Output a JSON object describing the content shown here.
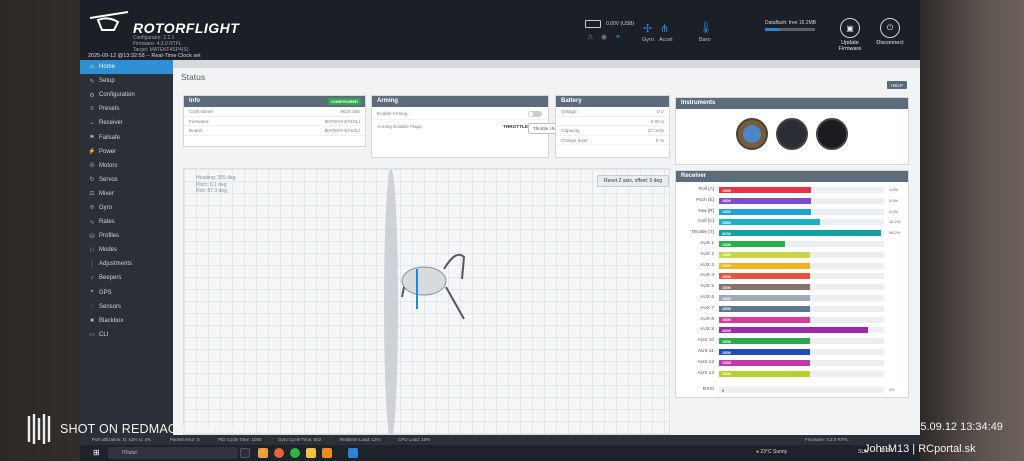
{
  "app": {
    "logo_text": "ROTORFLIGHT",
    "configurator": "Configurator: 2.2.1",
    "firmware": "Firmware: 4.3.0 RTFL",
    "target": "Target: MATEKF4SP4(S)",
    "datetime": "2025-09-12 @13:32:58 -- Real-Time Clock set"
  },
  "header": {
    "battery_value": "0.00V (USB)",
    "sensors": [
      {
        "icon": "gyro-icon",
        "label": "Gyro"
      },
      {
        "icon": "accel-icon",
        "label": "Accel"
      },
      {
        "icon": "baro-icon",
        "label": "Baro"
      }
    ],
    "dataflash": "Dataflash: free 16.2MB",
    "dataflash_used": 0.3,
    "update_label": "Update Firmware",
    "disconnect_label": "Disconnect"
  },
  "sidebar": {
    "items": [
      {
        "label": "Home",
        "icon": "home-icon",
        "active": true
      },
      {
        "label": "Setup",
        "icon": "wrench-icon"
      },
      {
        "label": "Configuration",
        "icon": "gear-icon"
      },
      {
        "label": "Presets",
        "icon": "presets-icon"
      },
      {
        "label": "Receiver",
        "icon": "receiver-icon"
      },
      {
        "label": "Failsafe",
        "icon": "failsafe-icon"
      },
      {
        "label": "Power",
        "icon": "power-icon"
      },
      {
        "label": "Motors",
        "icon": "motor-icon"
      },
      {
        "label": "Servos",
        "icon": "servo-icon"
      },
      {
        "label": "Mixer",
        "icon": "mixer-icon"
      },
      {
        "label": "Gyro",
        "icon": "gyro-icon"
      },
      {
        "label": "Rates",
        "icon": "rates-icon"
      },
      {
        "label": "Profiles",
        "icon": "profiles-icon"
      },
      {
        "label": "Modes",
        "icon": "modes-icon"
      },
      {
        "label": "Adjustments",
        "icon": "adjustments-icon"
      },
      {
        "label": "Beepers",
        "icon": "beeper-icon"
      },
      {
        "label": "GPS",
        "icon": "gps-icon"
      },
      {
        "label": "Sensors",
        "icon": "sensors-icon"
      },
      {
        "label": "Blackbox",
        "icon": "blackbox-icon"
      },
      {
        "label": "CLI",
        "icon": "cli-icon"
      }
    ]
  },
  "main": {
    "title": "Status",
    "help_label": "HELP",
    "info": {
      "title": "Info",
      "badge": "CONFIGURED",
      "rows": [
        {
          "k": "Craft Name:",
          "v": "RDS 450"
        },
        {
          "k": "Firmware:",
          "v": "MATEKF4(#4SL)"
        },
        {
          "k": "Board:",
          "v": "MATEKF4(#4SL)"
        }
      ]
    },
    "arming": {
      "title": "Arming",
      "enable_label": "Enable Arming:",
      "flags_label": "Arming Disable Flags:",
      "flags_value": "THROTTLE",
      "tooltip": "Throttle channel is too high"
    },
    "battery": {
      "title": "Battery",
      "rows": [
        {
          "k": "Voltage:",
          "v": "0 V"
        },
        {
          "k": "",
          "v": "0.00 A"
        },
        {
          "k": "Capacity:",
          "v": "27 mAh"
        },
        {
          "k": "Charge level:",
          "v": "0 %"
        }
      ]
    },
    "instruments": {
      "title": "Instruments"
    },
    "attitude": {
      "heading": "Heading:  355 deg",
      "pitch": "Pitch:  0.1 deg",
      "roll": "Roll:  87.3 deg"
    },
    "reset_label": "Reset Z axis, offset: 0 deg",
    "receiver": {
      "title": "Receiver",
      "rssi_label": "RSSI",
      "rssi_value": "0",
      "rssi_pct": "0%",
      "channels": [
        {
          "name": "Roll [A]",
          "value": "1500",
          "pct": "1.0%",
          "level": 0.56,
          "color": "#e8324a"
        },
        {
          "name": "Pitch [E]",
          "value": "1500",
          "pct": "0.0%",
          "level": 0.56,
          "color": "#7a4ec9"
        },
        {
          "name": "Yaw [R]",
          "value": "1501",
          "pct": "0.0%",
          "level": 0.56,
          "color": "#21a0d8"
        },
        {
          "name": "Coll [C]",
          "value": "1593",
          "pct": "18.2%",
          "level": 0.61,
          "color": "#19b3c7"
        },
        {
          "name": "Throttle [T]",
          "value": "2002",
          "pct": "98.2%",
          "level": 0.98,
          "color": "#11a2a0"
        },
        {
          "name": "AUX 1",
          "value": "1300",
          "pct": "",
          "level": 0.4,
          "color": "#23b34a"
        },
        {
          "name": "AUX 2",
          "value": "1500",
          "pct": "",
          "level": 0.55,
          "color": "#c9d44a"
        },
        {
          "name": "AUX 3",
          "value": "1500",
          "pct": "",
          "level": 0.55,
          "color": "#f2b31c"
        },
        {
          "name": "AUX 4",
          "value": "1500",
          "pct": "",
          "level": 0.55,
          "color": "#e8533a"
        },
        {
          "name": "AUX 5",
          "value": "1500",
          "pct": "",
          "level": 0.55,
          "color": "#8a6f6a"
        },
        {
          "name": "AUX 6",
          "value": "1500",
          "pct": "",
          "level": 0.55,
          "color": "#a0aab4"
        },
        {
          "name": "AUX 7",
          "value": "1500",
          "pct": "",
          "level": 0.55,
          "color": "#5b7a8c"
        },
        {
          "name": "AUX 8",
          "value": "1500",
          "pct": "",
          "level": 0.55,
          "color": "#d63c9a"
        },
        {
          "name": "AUX 9",
          "value": "2000",
          "pct": "",
          "level": 0.9,
          "color": "#9b2aa8"
        },
        {
          "name": "AUX 10",
          "value": "1500",
          "pct": "",
          "level": 0.55,
          "color": "#2aa84f"
        },
        {
          "name": "AUX 11",
          "value": "1500",
          "pct": "",
          "level": 0.55,
          "color": "#1e4fb8"
        },
        {
          "name": "AUX 12",
          "value": "1500",
          "pct": "",
          "level": 0.55,
          "color": "#c23aa6"
        },
        {
          "name": "AUX 13",
          "value": "1500",
          "pct": "",
          "level": 0.55,
          "color": "#b7d02a"
        }
      ]
    }
  },
  "statusbar": {
    "items": [
      "Port utilization: D: 53% U: 4%",
      "Packet error: 0",
      "PID Cycle Time: 1000",
      "Gyro Cycle Time: 502",
      "Realtime Load: 12%",
      "CPU Load: 10%"
    ],
    "version": "Firmware: 4.3.0 RTFL"
  },
  "taskbar": {
    "search_placeholder": "Hľadať",
    "weather": "23°C  Sunny",
    "lang": "SUK",
    "clock": "13:34"
  },
  "overlay": {
    "camera": "SHOT ON REDMAGIC 8S Pro",
    "date": "2025.09.12 13:34:49",
    "author": "JohnM13 | RCportal.sk"
  }
}
